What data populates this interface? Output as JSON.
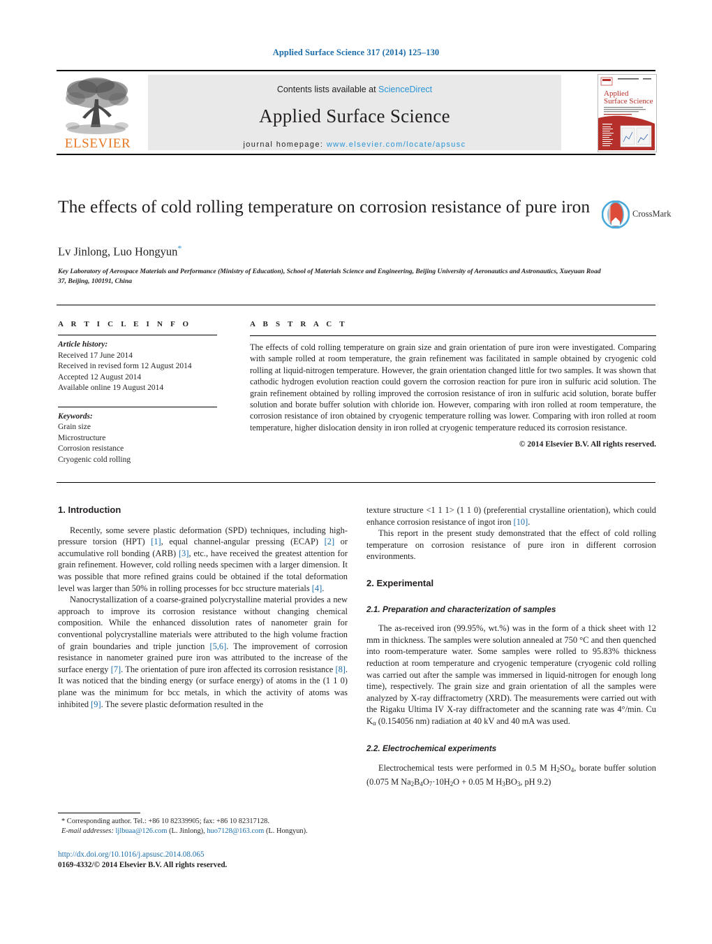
{
  "running_head": "Applied Surface Science 317 (2014) 125–130",
  "masthead": {
    "contents_prefix": "Contents lists available at ",
    "contents_link": "ScienceDirect",
    "journal_title": "Applied Surface Science",
    "homepage_prefix": "journal homepage: ",
    "homepage_url": "www.elsevier.com/locate/apsusc",
    "publisher_name": "ELSEVIER",
    "cover_title_line1": "Applied",
    "cover_title_line2": "Surface Science"
  },
  "article": {
    "title": "The effects of cold rolling temperature on corrosion resistance of pure iron",
    "authors": "Lv Jinlong, Luo Hongyun",
    "corresponding_marker": "*",
    "affiliation": "Key Laboratory of Aerospace Materials and Performance (Ministry of Education), School of Materials Science and Engineering, Beijing University of Aeronautics and Astronautics, Xueyuan Road 37, Beijing, 100191, China",
    "crossmark_label": "CrossMark"
  },
  "article_info": {
    "heading": "A R T I C L E    I N F O",
    "history_label": "Article history:",
    "history": [
      "Received 17 June 2014",
      "Received in revised form 12 August 2014",
      "Accepted 12 August 2014",
      "Available online 19 August 2014"
    ],
    "keywords_label": "Keywords:",
    "keywords": [
      "Grain size",
      "Microstructure",
      "Corrosion resistance",
      "Cryogenic cold rolling"
    ]
  },
  "abstract": {
    "heading": "A B S T R A C T",
    "text": "The effects of cold rolling temperature on grain size and grain orientation of pure iron were investigated. Comparing with sample rolled at room temperature, the grain refinement was facilitated in sample obtained by cryogenic cold rolling at liquid-nitrogen temperature. However, the grain orientation changed little for two samples. It was shown that cathodic hydrogen evolution reaction could govern the corrosion reaction for pure iron in sulfuric acid solution. The grain refinement obtained by rolling improved the corrosion resistance of iron in sulfuric acid solution, borate buffer solution and borate buffer solution with chloride ion. However, comparing with iron rolled at room temperature, the corrosion resistance of iron obtained by cryogenic temperature rolling was lower. Comparing with iron rolled at room temperature, higher dislocation density in iron rolled at cryogenic temperature reduced its corrosion resistance.",
    "copyright": "© 2014 Elsevier B.V. All rights reserved."
  },
  "sections": {
    "introduction_heading": "1.  Introduction",
    "intro_p1_a": "Recently, some severe plastic deformation (SPD) techniques, including high-pressure torsion (HPT) ",
    "intro_p1_r1": "[1]",
    "intro_p1_b": ", equal channel-angular pressing (ECAP) ",
    "intro_p1_r2": "[2]",
    "intro_p1_c": " or accumulative roll bonding (ARB) ",
    "intro_p1_r3": "[3]",
    "intro_p1_d": ", etc., have received the greatest attention for grain refinement. However, cold rolling needs specimen with a larger dimension. It was possible that more refined grains could be obtained if the total deformation level was larger than 50% in rolling processes for bcc structure materials ",
    "intro_p1_r4": "[4]",
    "intro_p1_e": ".",
    "intro_p2_a": "Nanocrystallization of a coarse-grained polycrystalline material provides a new approach to improve its corrosion resistance without changing chemical composition. While the enhanced dissolution rates of nanometer grain for conventional polycrystalline materials were attributed to the high volume fraction of grain boundaries and triple junction ",
    "intro_p2_r1": "[5,6]",
    "intro_p2_b": ". The improvement of corrosion resistance in nanometer grained pure iron was attributed to the increase of the surface energy ",
    "intro_p2_r2": "[7]",
    "intro_p2_c": ". The orientation of pure iron affected its corrosion resistance ",
    "intro_p2_r3": "[8]",
    "intro_p2_d": ". It was noticed that the binding energy (or surface energy) of atoms in the (1 1 0) plane was the minimum for bcc metals, in which the activity of atoms was inhibited ",
    "intro_p2_r4": "[9]",
    "intro_p2_e": ". The severe plastic deformation resulted in the",
    "intro_p2_cont_a": "texture structure <1 1 1> (1 1 0) (preferential crystalline orientation), which could enhance corrosion resistance of ingot iron ",
    "intro_p2_cont_r": "[10]",
    "intro_p2_cont_b": ".",
    "intro_p3": "This report in the present study demonstrated that the effect of cold rolling temperature on corrosion resistance of pure iron in different corrosion environments.",
    "experimental_heading": "2.  Experimental",
    "sub21_heading": "2.1.  Preparation and characterization of samples",
    "sub21_text_a": "The as-received iron (99.95%, wt.%) was in the form of a thick sheet with 12 mm in thickness. The samples were solution annealed at 750 °C and then quenched into room-temperature water. Some samples were rolled to 95.83% thickness reduction at room temperature and cryogenic temperature (cryogenic cold rolling was carried out after the sample was immersed in liquid-nitrogen for enough long time), respectively. The grain size and grain orientation of all the samples were analyzed by X-ray diffractometry (XRD). The measurements were carried out with the Rigaku Ultima IV X-ray diffractometer and the scanning rate was 4°/min. Cu K",
    "sub21_ksub": "α",
    "sub21_text_b": " (0.154056 nm) radiation at 40 kV and 40 mA was used.",
    "sub22_heading": "2.2.  Electrochemical experiments",
    "sub22_text_a": "Electrochemical tests were performed in 0.5 M H",
    "sub22_text_b": "SO",
    "sub22_text_c": ", borate buffer solution (0.075 M Na",
    "sub22_text_d": "B",
    "sub22_text_e": "O",
    "sub22_text_f": "·10H",
    "sub22_text_g": "O + 0.05 M H",
    "sub22_text_h": "BO",
    "sub22_text_i": ", pH 9.2)"
  },
  "footer": {
    "corresponding": "* Corresponding author. Tel.: +86 10 82339905; fax: +86 10 82317128.",
    "email_label": "E-mail addresses:",
    "email1": "ljlbuaa@126.com",
    "email1_owner": " (L. Jinlong), ",
    "email2": "huo7128@163.com",
    "email2_owner": " (L. Hongyun).",
    "doi": "http://dx.doi.org/10.1016/j.apsusc.2014.08.065",
    "issn": "0169-4332/© 2014 Elsevier B.V. All rights reserved."
  },
  "colors": {
    "link_blue": "#1c6ca8",
    "sciencedirect_blue": "#2a94d6",
    "elsevier_orange": "#E87722",
    "cover_red": "#b5302a"
  }
}
